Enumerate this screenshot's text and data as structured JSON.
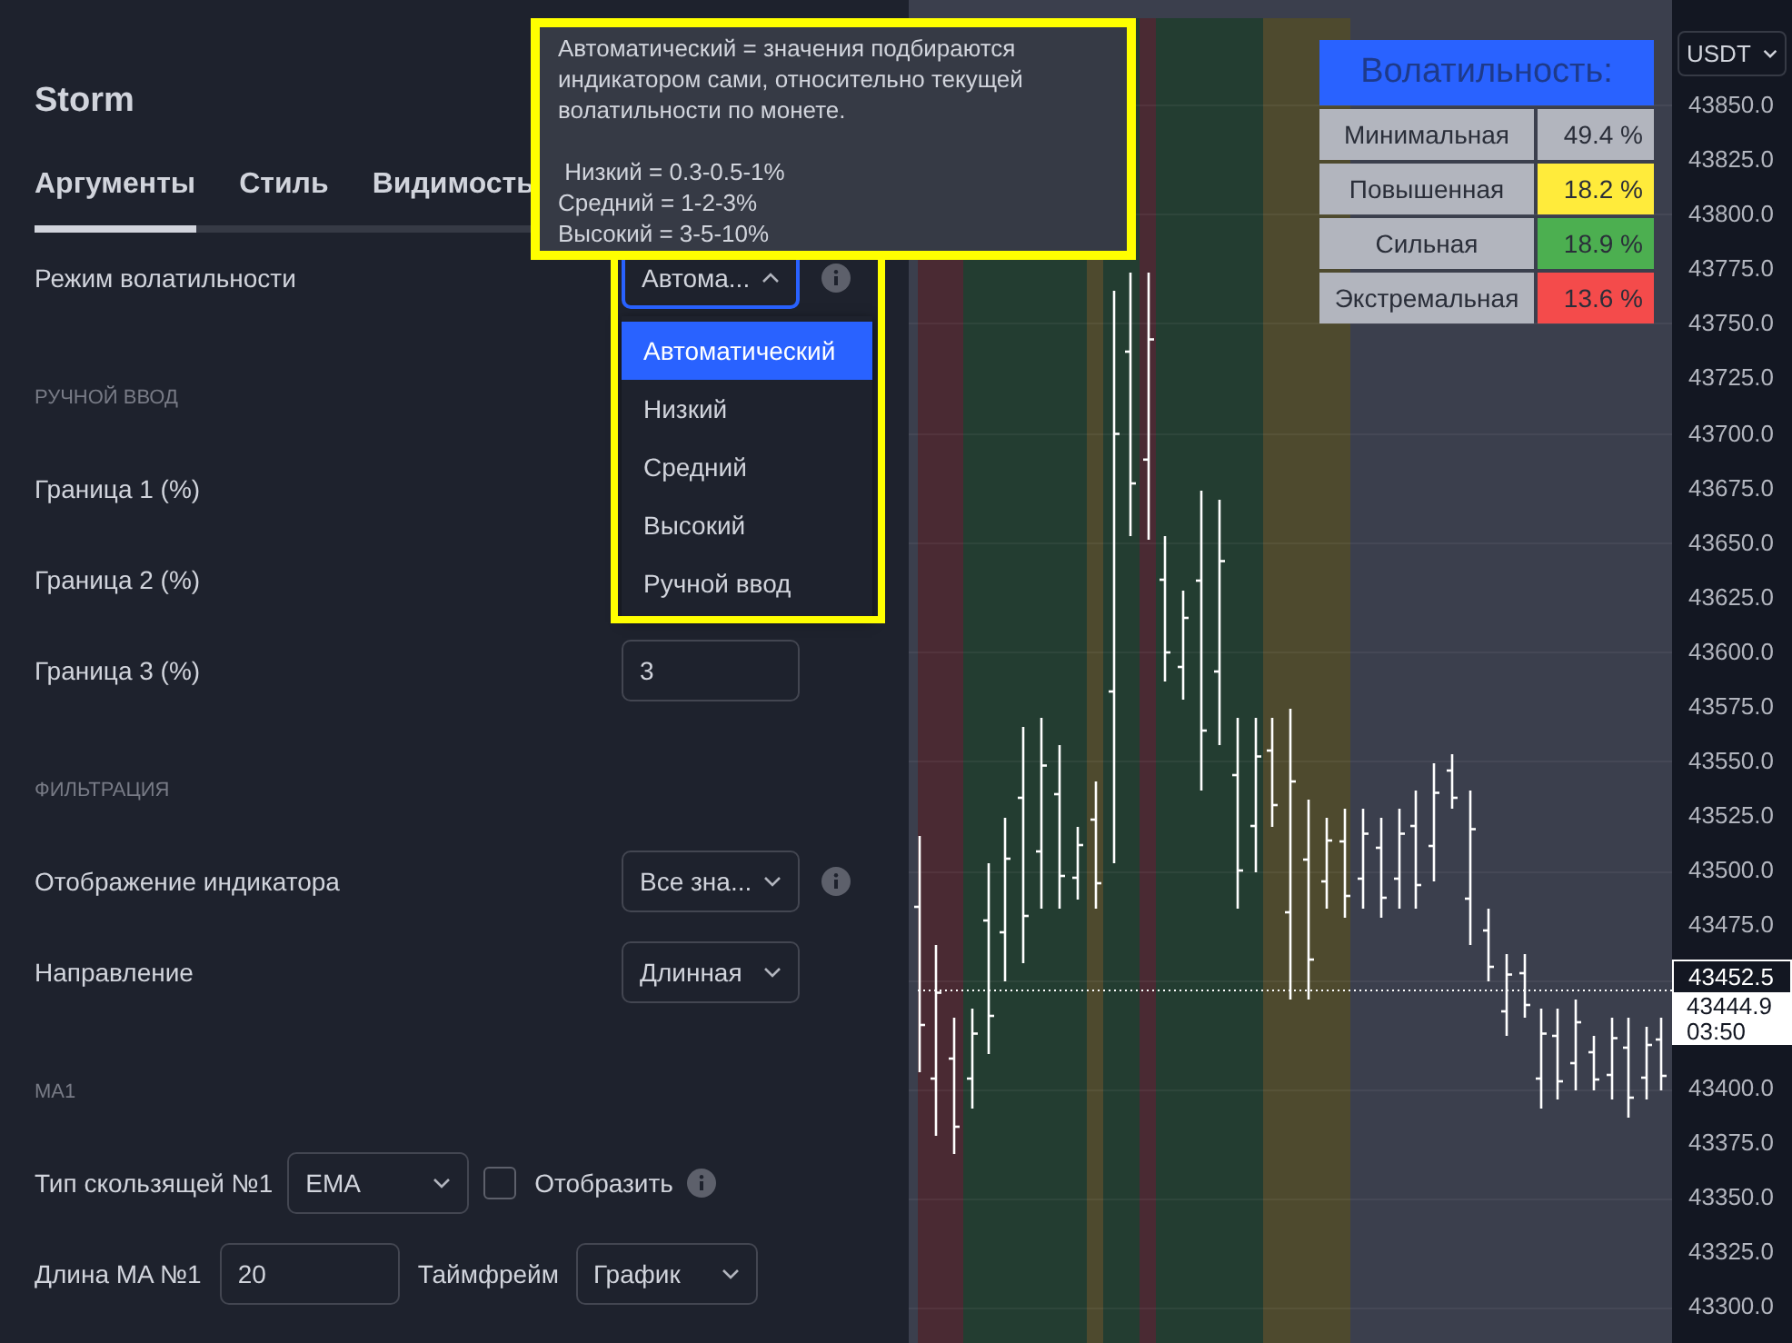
{
  "dialog": {
    "title": "Storm",
    "tabs": [
      {
        "label": "Аргументы",
        "selected": true
      },
      {
        "label": "Стиль",
        "selected": false
      },
      {
        "label": "Видимость",
        "selected": false
      }
    ],
    "rows": [
      {
        "kind": "select",
        "label": "Режим волатильности",
        "value": "Автома...",
        "expanded": true,
        "focused": true,
        "info": true,
        "options": [
          {
            "label": "Автоматический",
            "selected": true
          },
          {
            "label": "Низкий",
            "selected": false
          },
          {
            "label": "Средний",
            "selected": false
          },
          {
            "label": "Высокий",
            "selected": false
          },
          {
            "label": "Ручной ввод",
            "selected": false
          }
        ]
      },
      {
        "kind": "section",
        "label": "РУЧНОЙ ВВОД"
      },
      {
        "kind": "label",
        "label": "Граница 1 (%)"
      },
      {
        "kind": "label",
        "label": "Граница 2 (%)"
      },
      {
        "kind": "input",
        "label": "Граница 3 (%)",
        "value": "3"
      },
      {
        "kind": "section",
        "label": "ФИЛЬТРАЦИЯ"
      },
      {
        "kind": "select",
        "label": "Отображение индикатора",
        "value": "Все зна...",
        "expanded": false,
        "focused": false,
        "info": true
      },
      {
        "kind": "select",
        "label": "Направление",
        "value": "Длинная",
        "expanded": false,
        "focused": false,
        "info": false
      },
      {
        "kind": "section",
        "label": "MA1"
      },
      {
        "kind": "inline",
        "label": "Тип скользящей №1",
        "controls": [
          {
            "kind": "select",
            "value": "EMA"
          },
          {
            "kind": "checkbox",
            "label": "Отобразить",
            "checked": false
          },
          {
            "kind": "info"
          }
        ]
      },
      {
        "kind": "inline",
        "label": "Длина MA №1",
        "controls": [
          {
            "kind": "input",
            "value": "20"
          },
          {
            "kind": "text",
            "label": "Таймфрейм"
          },
          {
            "kind": "select",
            "value": "График"
          }
        ]
      }
    ]
  },
  "tooltip": {
    "paragraph": "Автоматический = значения подбираются индикатором сами, относительно текущей волатильности по монете.",
    "lines": [
      " Низкий = 0.3-0.5-1%",
      "Средний = 1-2-3%",
      "Высокий = 3-5-10%"
    ]
  },
  "volatility_table": {
    "title": "Волатильность:",
    "rows": [
      {
        "label": "Минимальная",
        "value": "49.4 %",
        "color": "#b2b5be"
      },
      {
        "label": "Повышенная",
        "value": "18.2 %",
        "color": "#ffeb3b"
      },
      {
        "label": "Сильная",
        "value": "18.9 %",
        "color": "#4caf50"
      },
      {
        "label": "Экстремальная",
        "value": "13.6 %",
        "color": "#f44b4b"
      }
    ]
  },
  "price_axis": {
    "currency": "USDT",
    "upper_labels": [
      "43850.0",
      "43825.0",
      "43800.0",
      "43775.0",
      "43750.0",
      "43725.0",
      "43700.0",
      "43675.0",
      "43650.0",
      "43625.0",
      "43600.0",
      "43575.0",
      "43550.0",
      "43525.0",
      "43500.0",
      "43475.0"
    ],
    "current_price": "43452.5",
    "last_price": "43444.9",
    "countdown": "03:50",
    "lower_labels": [
      "43400.0",
      "43375.0",
      "43350.0",
      "43325.0",
      "43300.0"
    ]
  }
}
